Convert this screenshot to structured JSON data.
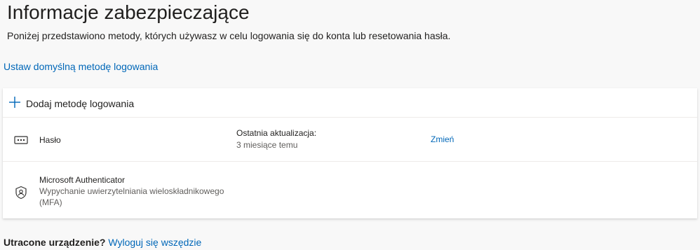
{
  "page": {
    "title": "Informacje zabezpieczające",
    "subtitle": "Poniżej przedstawiono metody, których używasz w celu logowania się do konta lub resetowania hasła.",
    "default_method_link": "Ustaw domyślną metodę logowania"
  },
  "methods_card": {
    "add_method_label": "Dodaj metodę logowania",
    "add_icon": "plus-icon",
    "methods": [
      {
        "icon": "password-icon",
        "name": "Hasło",
        "update_label": "Ostatnia aktualizacja:",
        "update_value": "3 miesiące temu",
        "action_label": "Zmień"
      },
      {
        "icon": "authenticator-icon",
        "name": "Microsoft Authenticator",
        "description": "Wypychanie uwierzytelniania wieloskładnikowego (MFA)"
      }
    ]
  },
  "footer": {
    "lost_device_label": "Utracone urządzenie?",
    "sign_out_everywhere_link": "Wyloguj się wszędzie"
  },
  "colors": {
    "accent": "#0067b8",
    "background": "#f8f8f8",
    "card": "#ffffff",
    "text_primary": "#201f1e",
    "text_secondary": "#605e5c"
  }
}
